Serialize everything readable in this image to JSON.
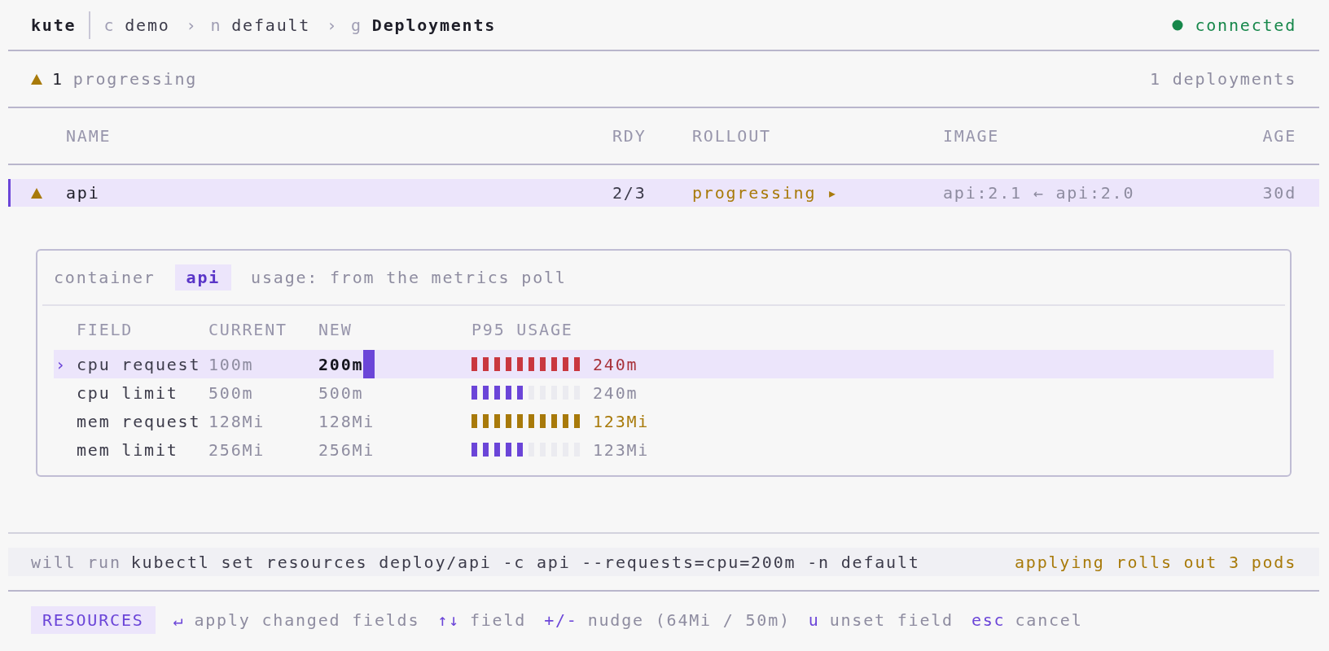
{
  "header": {
    "app": "kute",
    "crumbs": [
      {
        "prefix": "c",
        "label": "demo",
        "current": false
      },
      {
        "separator": "›",
        "prefix": "n",
        "label": "default",
        "current": false
      },
      {
        "separator": "›",
        "prefix": "g",
        "label": "Deployments",
        "current": true
      }
    ],
    "connection": {
      "label": "connected",
      "connected": true
    }
  },
  "summary": {
    "kind": "warning",
    "count": "1",
    "label": "progressing",
    "total": "1 deployments"
  },
  "table": {
    "columns": [
      "NAME",
      "RDY",
      "ROLLOUT",
      "IMAGE",
      "AGE"
    ],
    "rows": [
      {
        "kind": "warning",
        "selected": true,
        "name": "api",
        "ready": "2/3",
        "rollout": "progressing ▸",
        "image": "api:2.1 ← api:2.0",
        "age": "30d"
      }
    ]
  },
  "editor": {
    "container_label": "container",
    "container": "api",
    "note": "usage: from the metrics poll",
    "pointer": "›",
    "columns": [
      "FIELD",
      "CURRENT",
      "NEW",
      "P95 USAGE"
    ],
    "fields": [
      {
        "field": "cpu request",
        "current": "100m",
        "new": "200m",
        "changed": true,
        "selected": true,
        "usage": {
          "level": 1,
          "kind": "over",
          "reading": "240m"
        }
      },
      {
        "field": "cpu limit",
        "current": "500m",
        "new": "500m",
        "changed": false,
        "selected": false,
        "usage": {
          "level": 0.5,
          "kind": "ok",
          "reading": "240m"
        }
      },
      {
        "field": "mem request",
        "current": "128Mi",
        "new": "128Mi",
        "changed": false,
        "selected": false,
        "usage": {
          "level": 1,
          "kind": "warn",
          "reading": "123Mi"
        }
      },
      {
        "field": "mem limit",
        "current": "256Mi",
        "new": "256Mi",
        "changed": false,
        "selected": false,
        "usage": {
          "level": 0.5,
          "kind": "ok",
          "reading": "123Mi"
        }
      }
    ]
  },
  "command": {
    "label": "will run",
    "text": "kubectl set resources deploy/api -c api --requests=cpu=200m -n default",
    "warning": "applying rolls out 3 pods"
  },
  "footer": {
    "mode": "RESOURCES",
    "hints": [
      {
        "key": "↵",
        "label": "apply changed fields"
      },
      {
        "key": "↑↓",
        "label": "field"
      },
      {
        "key": "+/-",
        "label": "nudge (64Mi / 50m)"
      },
      {
        "key": "u",
        "label": "unset field"
      },
      {
        "key": "esc",
        "label": "cancel"
      }
    ]
  }
}
